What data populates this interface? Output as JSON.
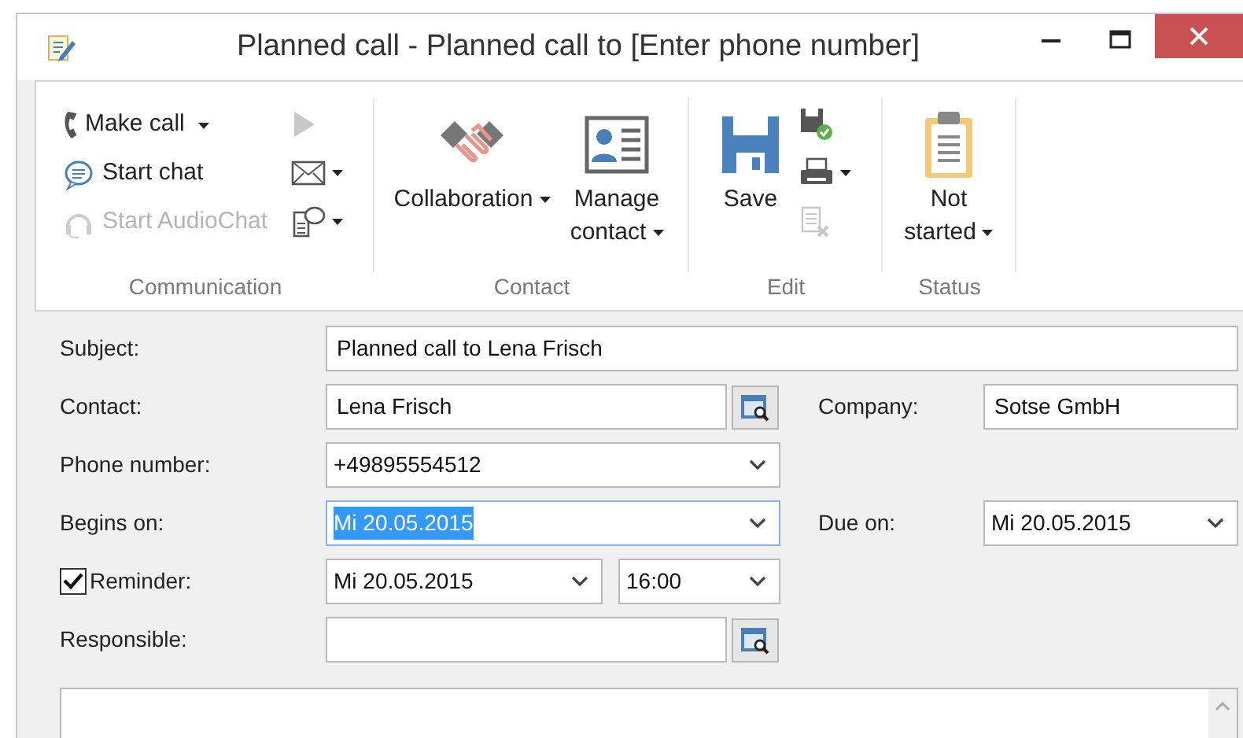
{
  "window": {
    "title": "Planned call - Planned call to [Enter phone number]"
  },
  "ribbon": {
    "groups": [
      {
        "label": "Communication",
        "items": [
          {
            "kind": "small",
            "label": "Make call",
            "dropdown": true,
            "disabled": false
          },
          {
            "kind": "small",
            "label": "Start chat",
            "dropdown": false,
            "disabled": false
          },
          {
            "kind": "small",
            "label": "Start AudioChat",
            "dropdown": false,
            "disabled": true
          },
          {
            "kind": "icon",
            "dropdown": false,
            "disabled": true
          },
          {
            "kind": "icon",
            "dropdown": true,
            "disabled": false
          },
          {
            "kind": "icon",
            "dropdown": true,
            "disabled": false
          }
        ]
      },
      {
        "label": "Contact",
        "items": [
          {
            "kind": "large",
            "label": "Collaboration",
            "dropdown": true,
            "disabled": false
          },
          {
            "kind": "large",
            "label": "Manage contact",
            "dropdown": true,
            "disabled": false
          }
        ]
      },
      {
        "label": "Edit",
        "items": [
          {
            "kind": "large",
            "label": "Save",
            "dropdown": false,
            "disabled": false
          },
          {
            "kind": "icon",
            "dropdown": false,
            "disabled": false
          },
          {
            "kind": "icon",
            "dropdown": true,
            "disabled": false
          },
          {
            "kind": "icon",
            "dropdown": false,
            "disabled": true
          }
        ]
      },
      {
        "label": "Status",
        "items": [
          {
            "kind": "large",
            "label": "Not started",
            "dropdown": true,
            "disabled": false
          }
        ]
      }
    ]
  },
  "form": {
    "subject": {
      "label": "Subject:",
      "value": "Planned call to Lena Frisch"
    },
    "contact": {
      "label": "Contact:",
      "value": "Lena Frisch"
    },
    "company": {
      "label": "Company:",
      "value": "Sotse GmbH"
    },
    "phone": {
      "label": "Phone number:",
      "value": "+49895554512"
    },
    "begins_on": {
      "label": "Begins on:",
      "value": "Mi 20.05.2015",
      "selected": true
    },
    "due_on": {
      "label": "Due on:",
      "value": "Mi 20.05.2015",
      "selected": false
    },
    "reminder": {
      "label": "Reminder:",
      "checked": true,
      "date": "Mi 20.05.2015",
      "time": "16:00"
    },
    "responsible": {
      "label": "Responsible:"
    }
  }
}
